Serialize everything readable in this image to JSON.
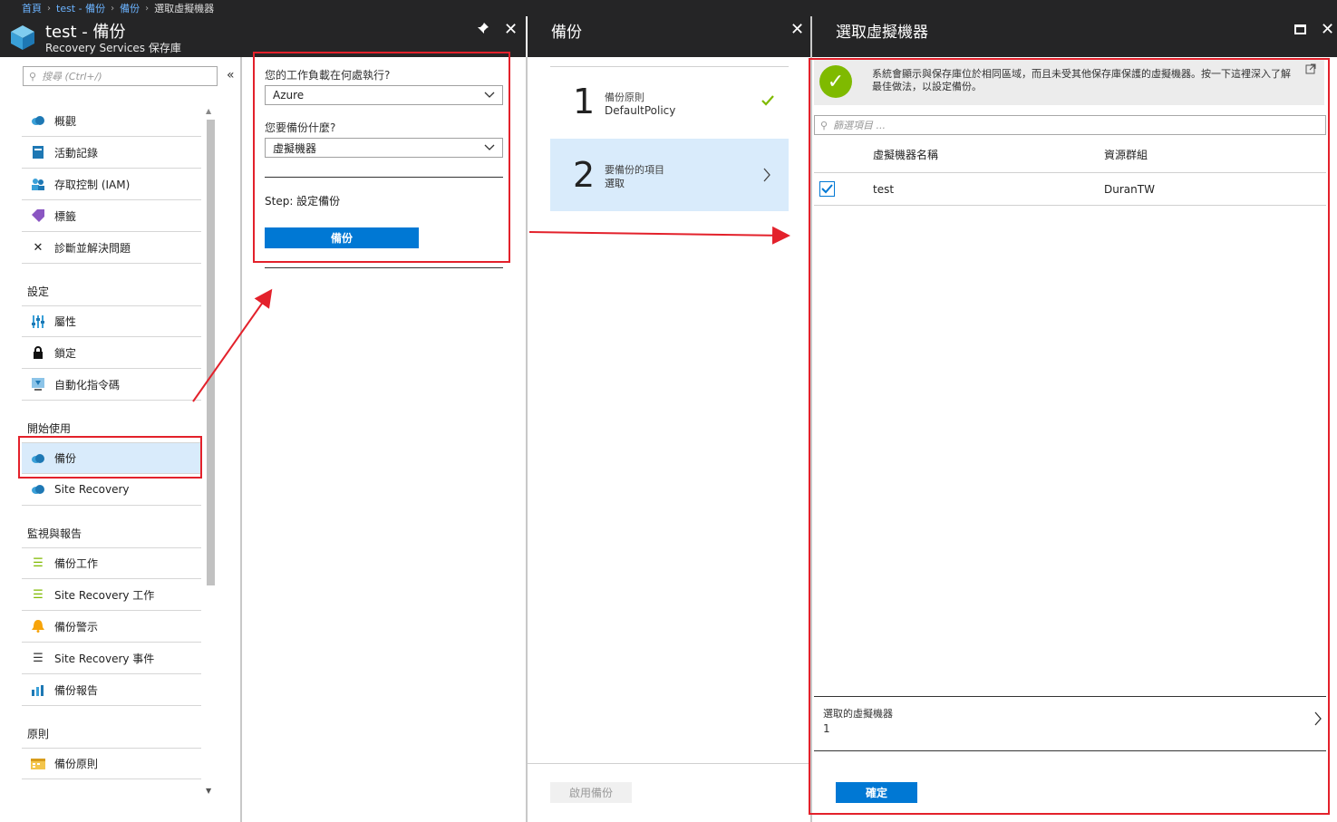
{
  "breadcrumb": {
    "home": "首頁",
    "vault": "test - 備份",
    "backup": "備份",
    "current": "選取虛擬機器"
  },
  "panel1": {
    "title": "test - 備份",
    "subtitle": "Recovery Services 保存庫",
    "search_placeholder": "搜尋 (Ctrl+/)",
    "collapse": "«",
    "nav": [
      {
        "label": "概觀",
        "icon": "cloud-icon"
      },
      {
        "label": "活動記錄",
        "icon": "log-icon"
      },
      {
        "label": "存取控制 (IAM)",
        "icon": "users-icon"
      },
      {
        "label": "標籤",
        "icon": "tag-icon"
      },
      {
        "label": "診斷並解決問題",
        "icon": "wrench-icon"
      }
    ],
    "section_settings": "設定",
    "settings": [
      {
        "label": "屬性",
        "icon": "properties-icon"
      },
      {
        "label": "鎖定",
        "icon": "lock-icon"
      },
      {
        "label": "自動化指令碼",
        "icon": "download-icon"
      }
    ],
    "section_getting_started": "開始使用",
    "getting_started": [
      {
        "label": "備份",
        "icon": "cloud-icon"
      },
      {
        "label": "Site Recovery",
        "icon": "cloud-icon"
      }
    ],
    "section_monitoring": "監視與報告",
    "monitoring": [
      {
        "label": "備份工作",
        "icon": "list-icon"
      },
      {
        "label": "Site Recovery 工作",
        "icon": "list-icon"
      },
      {
        "label": "備份警示",
        "icon": "alert-icon"
      },
      {
        "label": "Site Recovery 事件",
        "icon": "list-icon"
      },
      {
        "label": "備份報告",
        "icon": "chart-icon"
      }
    ],
    "section_policy": "原則",
    "policy": [
      {
        "label": "備份原則",
        "icon": "calendar-icon"
      }
    ]
  },
  "config": {
    "workload_label": "您的工作負載在何處執行?",
    "workload_value": "Azure",
    "what_label": "您要備份什麼?",
    "what_value": "虛擬機器",
    "step_text": "Step: 設定備份",
    "backup_button": "備份"
  },
  "panel2": {
    "title": "備份",
    "steps": [
      {
        "number": "1",
        "label": "備份原則",
        "value": "DefaultPolicy"
      },
      {
        "number": "2",
        "label": "要備份的項目",
        "value": "選取"
      }
    ],
    "enable_button": "啟用備份"
  },
  "panel3": {
    "title": "選取虛擬機器",
    "info": "系統會顯示與保存庫位於相同區域，而且未受其他保存庫保護的虛擬機器。按一下這裡深入了解最佳做法，以設定備份。",
    "filter_placeholder": "篩選項目 ...",
    "columns": [
      "虛擬機器名稱",
      "資源群組"
    ],
    "rows": [
      {
        "name": "test",
        "resource_group": "DuranTW",
        "checked": true
      }
    ],
    "selected_label": "選取的虛擬機器",
    "selected_count": "1",
    "ok_button": "確定"
  },
  "colors": {
    "header_bg": "#252526",
    "accent": "#0078d4",
    "highlight": "#d9ebfb",
    "annotation_red": "#e3212b",
    "success_green": "#7fba00"
  }
}
